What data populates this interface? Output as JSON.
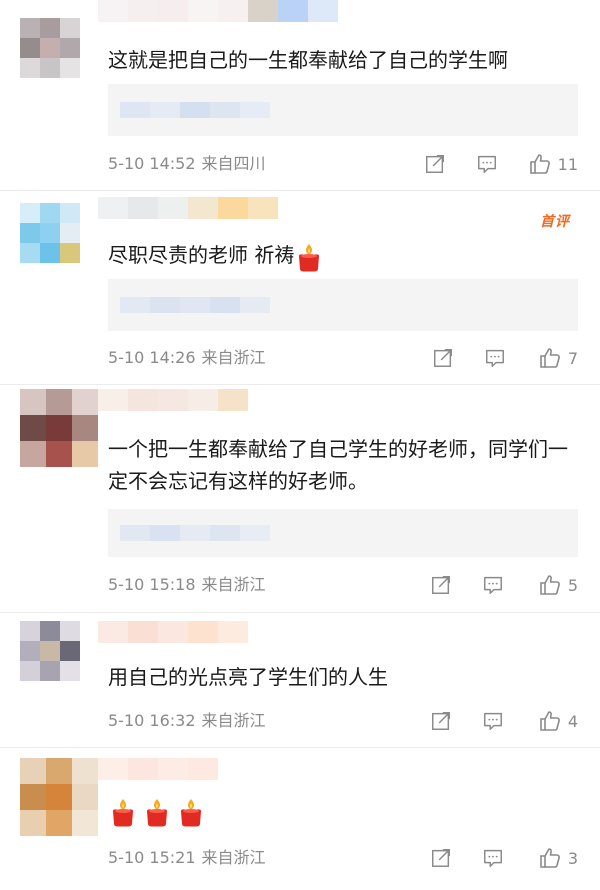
{
  "colors": {
    "accent": "#f26a21",
    "meta_text": "#8a8a8a",
    "quote_bg": "#f4f4f4"
  },
  "icons": {
    "share": "share-icon",
    "reply": "reply-icon",
    "like": "thumbs-up-icon",
    "candle": "candle-emoji"
  },
  "comments": [
    {
      "text": "这就是把自己的一生都奉献给了自己的学生啊",
      "time": "5-10 14:52",
      "location": "来自四川",
      "likes": "11"
    },
    {
      "text": "尽职尽责的老师 祈祷",
      "time": "5-10 14:26",
      "location": "来自浙江",
      "likes": "7",
      "badge": "首评"
    },
    {
      "text": "一个把一生都奉献给了自己学生的好老师，同学们一定不会忘记有这样的好老师。",
      "time": "5-10 15:18",
      "location": "来自浙江",
      "likes": "5"
    },
    {
      "text": "用自己的光点亮了学生们的人生",
      "time": "5-10 16:32",
      "location": "来自浙江",
      "likes": "4"
    },
    {
      "text": "",
      "time": "5-10 15:21",
      "location": "来自浙江",
      "likes": "3",
      "emoji_count": 3
    }
  ]
}
